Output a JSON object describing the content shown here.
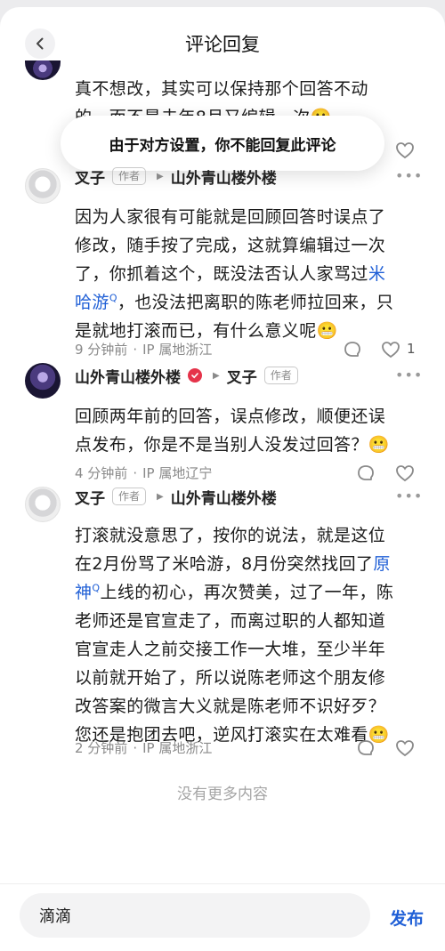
{
  "header": {
    "title": "评论回复"
  },
  "partial_comment": {
    "line1": "真不想改，其实可以保持那个回答不动",
    "line2": "的，而不是去年8月又编辑一次"
  },
  "toast": {
    "text": "由于对方设置，你不能回复此评论"
  },
  "comments": [
    {
      "author": "叉子",
      "author_tag": "作者",
      "reply_to": "山外青山楼外楼",
      "text_lines": [
        "因为人家很有可能就是回顾回答时误点了",
        "修改，随手按了完成，这就算编辑过一次",
        "了，你抓着这个，既没法否认人家骂过"
      ],
      "link1_part1": "米",
      "link1_part2": "哈游",
      "after_link1": "，也没法把离职的陈老师拉回来，只",
      "last_line": "是就地打滚而已，有什么意义呢",
      "time": "9 分钟前",
      "location": "IP 属地浙江",
      "likes": "1"
    },
    {
      "author": "山外青山楼外楼",
      "reply_to": "叉子",
      "reply_to_tag": "作者",
      "text_lines": [
        "回顾两年前的回答，误点修改，顺便还误",
        "点发布，你是不是当别人没发过回答？"
      ],
      "time": "4 分钟前",
      "location": "IP 属地辽宁"
    },
    {
      "author": "叉子",
      "author_tag": "作者",
      "reply_to": "山外青山楼外楼",
      "line1": "打滚就没意思了，按你的说法，就是这位",
      "line2_pre": "在2月份骂了米哈游，8月份突然找回了",
      "line2_link": "原",
      "line3_link": "神",
      "line3_post": "上线的初心，再次赞美，过了一年，陈",
      "text_lines": [
        "老师还是官宣走了，而离过职的人都知道",
        "官宣走人之前交接工作一大堆，至少半年",
        "以前就开始了，所以说陈老师这个朋友修",
        "改答案的微言大义就是陈老师不识好歹？"
      ],
      "last_line": "您还是抱团去吧，逆风打滚实在太难看",
      "time": "2 分钟前",
      "location": "IP 属地浙江"
    }
  ],
  "meta": {
    "sep": "·"
  },
  "footer": {
    "no_more": "没有更多内容"
  },
  "input": {
    "value": "滴滴",
    "send_label": "发布"
  },
  "colors": {
    "accent": "#1f5fd6",
    "muted": "#8a8a8a"
  }
}
